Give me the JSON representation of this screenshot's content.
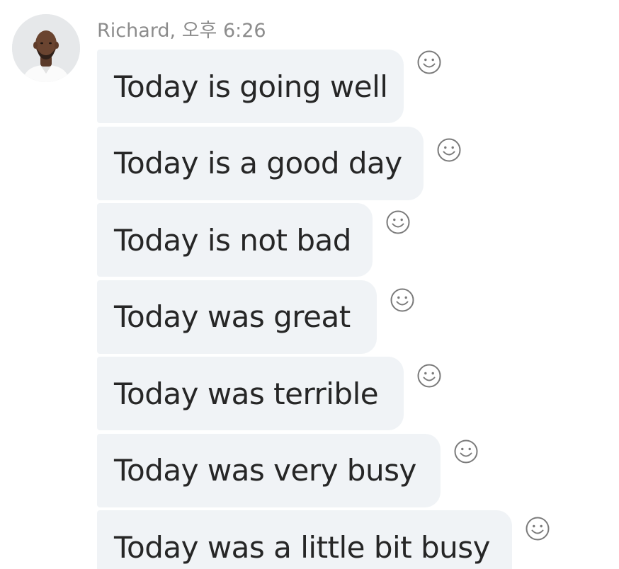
{
  "sender": {
    "name_time": "Richard, 오후 6:26"
  },
  "messages": [
    {
      "text": "Today is going well",
      "reaction_icon": "smiley-face-icon"
    },
    {
      "text": "Today is a good day",
      "reaction_icon": "smiley-face-icon"
    },
    {
      "text": "Today is not bad",
      "reaction_icon": "smiley-face-icon"
    },
    {
      "text": "Today was great",
      "reaction_icon": "smiley-face-icon"
    },
    {
      "text": "Today was terrible",
      "reaction_icon": "smiley-face-icon"
    },
    {
      "text": "Today was very busy",
      "reaction_icon": "smiley-face-icon"
    },
    {
      "text": "Today was a little bit busy",
      "reaction_icon": "smiley-face-icon"
    }
  ],
  "colors": {
    "bubble_bg": "#f0f3f6",
    "message_text": "#262626",
    "meta_text": "#8c8c8c",
    "icon_stroke": "#7a7a7a"
  }
}
